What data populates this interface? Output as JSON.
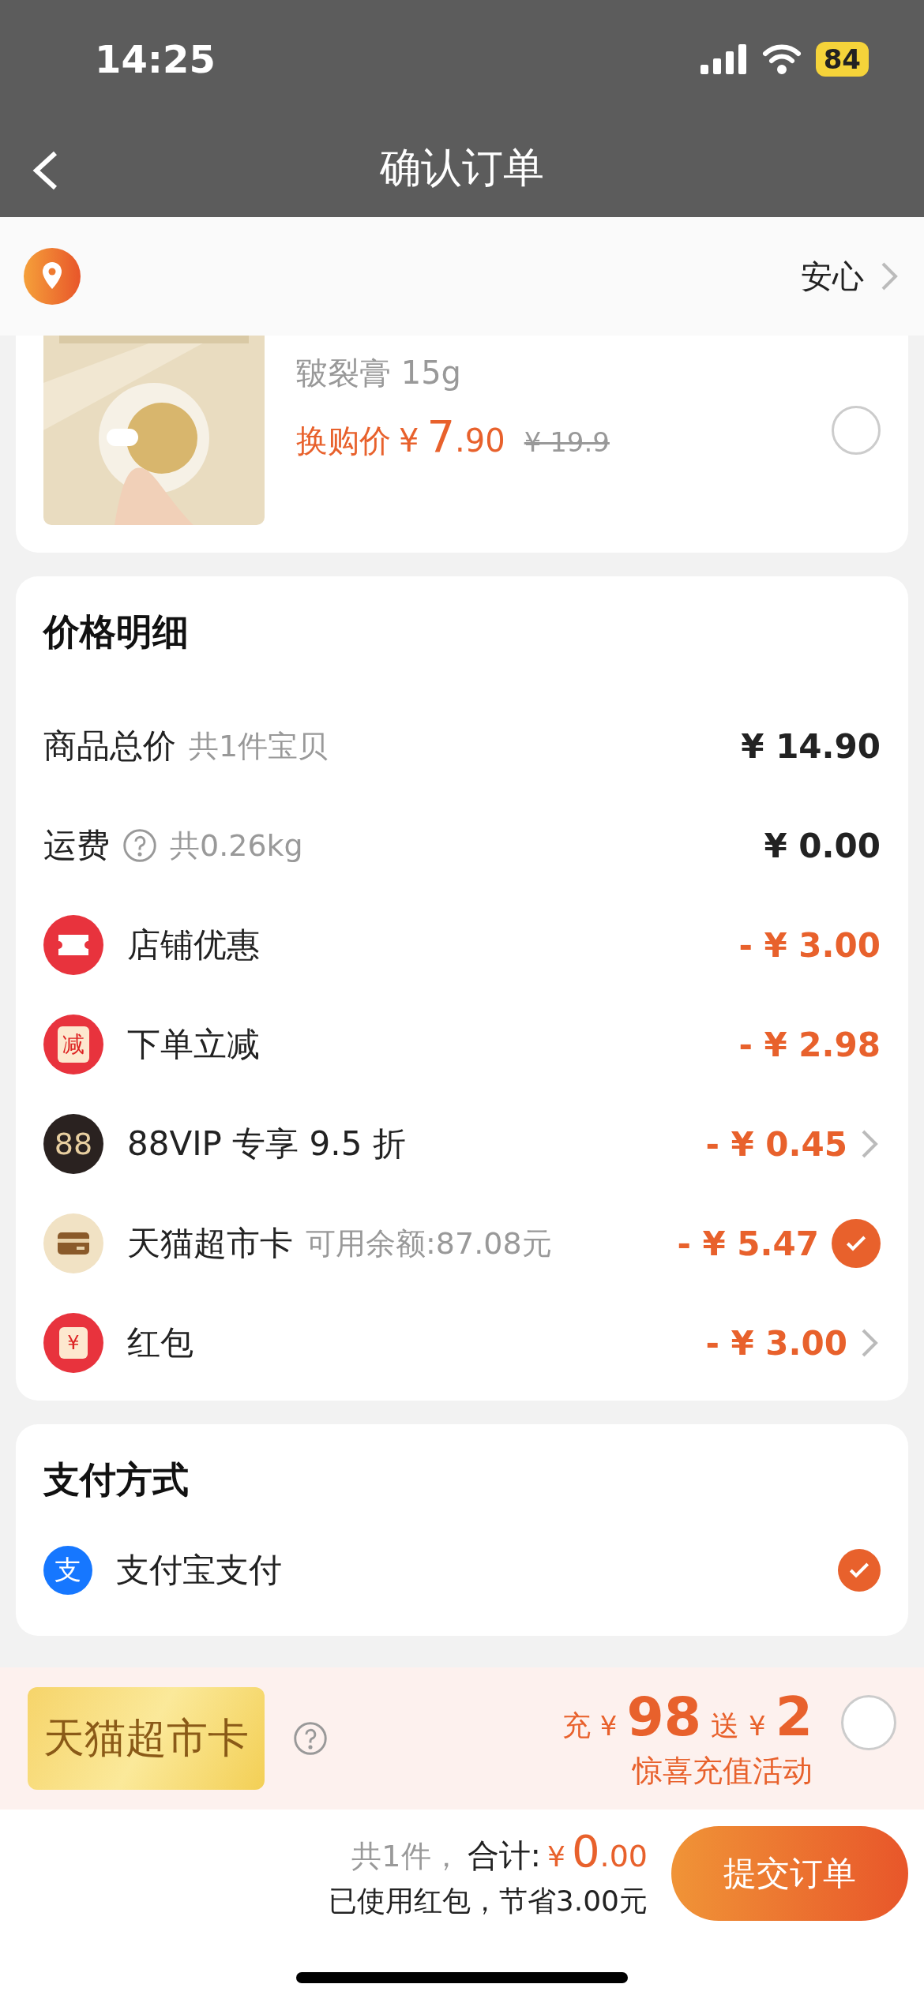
{
  "status_bar": {
    "time": "14:25",
    "battery": "84"
  },
  "nav": {
    "title": "确认订单"
  },
  "address": {
    "text": "安心"
  },
  "product": {
    "spec": "皲裂膏 15g",
    "price_label": "换购价",
    "currency": "¥",
    "price_int": "7",
    "price_dec": ".90",
    "original_price": "¥ 19.9",
    "selected": false
  },
  "price_details": {
    "title": "价格明细",
    "rows": [
      {
        "kind": "plain",
        "label": "商品总价",
        "note": "共1件宝贝",
        "amount": "¥ 14.90"
      },
      {
        "kind": "shipping",
        "label": "运费",
        "note": "共0.26kg",
        "amount": "¥ 0.00"
      },
      {
        "kind": "ticket",
        "label": "店铺优惠",
        "amount": "- ¥ 3.00",
        "chevron": false
      },
      {
        "kind": "coupon",
        "icon_text": "减",
        "label": "下单立减",
        "amount": "- ¥ 2.98",
        "chevron": false
      },
      {
        "kind": "vip",
        "icon_text": "88",
        "label": "88VIP 专享 9.5 折",
        "amount": "- ¥ 0.45",
        "chevron": true
      },
      {
        "kind": "card",
        "label": "天猫超市卡",
        "note": "可用余额:87.08元",
        "amount": "- ¥ 5.47",
        "checked": true
      },
      {
        "kind": "envelope",
        "icon_text": "¥",
        "label": "红包",
        "amount": "- ¥ 3.00",
        "chevron": true
      }
    ]
  },
  "payment": {
    "title": "支付方式",
    "method": {
      "icon_text": "支",
      "label": "支付宝支付",
      "selected": true
    }
  },
  "promo": {
    "card_label": "天猫超市卡",
    "charge": "充",
    "currency1": "¥",
    "charge_amount": "98",
    "bonus": "送",
    "currency2": "¥",
    "bonus_amount": "2",
    "subtitle": "惊喜充值活动",
    "selected": false
  },
  "footer": {
    "count": "共1件，",
    "total_label": "合计:",
    "currency": "¥",
    "total_int": "0",
    "total_dec": ".00",
    "saving": "已使用红包，节省3.00元",
    "button": "提交订单"
  }
}
